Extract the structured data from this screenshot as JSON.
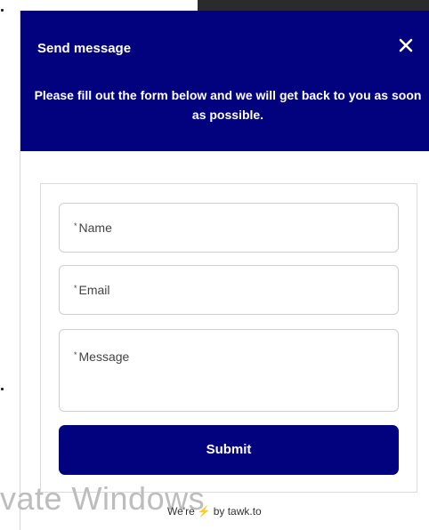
{
  "colors": {
    "accent": "#03027e"
  },
  "header": {
    "title": "Send message",
    "close_icon": "close-icon",
    "description": "Please fill out the form below and we will get back to you as soon as possible."
  },
  "form": {
    "required_mark": "*",
    "name_placeholder": "Name",
    "email_placeholder": "Email",
    "message_placeholder": "Message",
    "submit_label": "Submit"
  },
  "footer": {
    "prefix": "We're",
    "icon": "lightning-icon",
    "suffix": "by tawk.to"
  },
  "overlay": {
    "watermark": "vate Windows"
  }
}
